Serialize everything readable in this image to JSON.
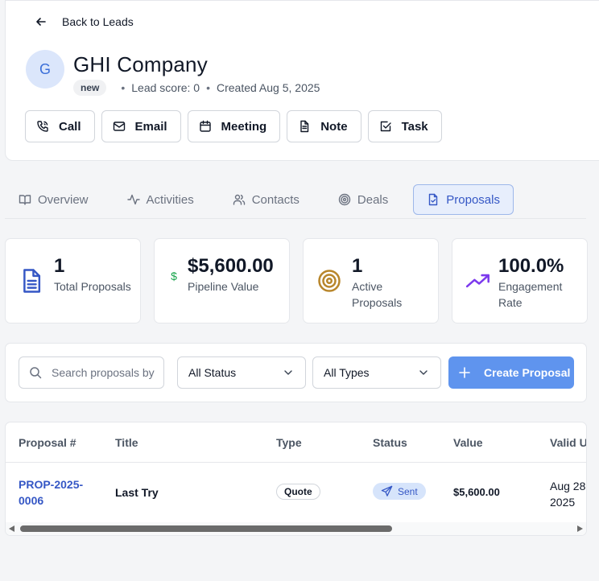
{
  "nav": {
    "back_label": "Back to Leads"
  },
  "lead": {
    "avatar_initial": "G",
    "name": "GHI Company",
    "status_badge": "new",
    "lead_score": "Lead score: 0",
    "created": "Created Aug 5, 2025"
  },
  "actions": [
    {
      "label": "Call",
      "icon": "phone-icon"
    },
    {
      "label": "Email",
      "icon": "mail-icon"
    },
    {
      "label": "Meeting",
      "icon": "calendar-icon"
    },
    {
      "label": "Note",
      "icon": "document-icon"
    },
    {
      "label": "Task",
      "icon": "checkbox-icon"
    }
  ],
  "tabs": [
    {
      "label": "Overview",
      "icon": "book-icon",
      "active": false
    },
    {
      "label": "Activities",
      "icon": "activity-icon",
      "active": false
    },
    {
      "label": "Contacts",
      "icon": "users-icon",
      "active": false
    },
    {
      "label": "Deals",
      "icon": "target-icon",
      "active": false
    },
    {
      "label": "Proposals",
      "icon": "file-check-icon",
      "active": true
    }
  ],
  "stats": [
    {
      "value": "1",
      "label": "Total Proposals",
      "icon": "document-icon",
      "color": "#3557c5"
    },
    {
      "value": "$5,600.00",
      "label": "Pipeline Value",
      "icon": "dollar-icon",
      "color": "#16a34a"
    },
    {
      "value": "1",
      "label": "Active Proposals",
      "icon": "target-icon",
      "color": "#b8862b"
    },
    {
      "value": "100.0%",
      "label": "Engagement Rate",
      "icon": "trending-up-icon",
      "color": "#7c3aed"
    }
  ],
  "filters": {
    "search_placeholder": "Search proposals by",
    "status_select": "All Status",
    "type_select": "All Types",
    "create_button": "Create Proposal"
  },
  "table": {
    "columns": [
      "Proposal #",
      "Title",
      "Type",
      "Status",
      "Value",
      "Valid U"
    ],
    "rows": [
      {
        "proposal_number": "PROP-2025-0006",
        "title": "Last Try",
        "type": "Quote",
        "status": "Sent",
        "value": "$5,600.00",
        "valid_until": "Aug 28 2025"
      }
    ]
  },
  "colors": {
    "accent": "#3557c5",
    "primary_button": "#5f94ee",
    "active_tab_bg": "#e7eefc"
  }
}
